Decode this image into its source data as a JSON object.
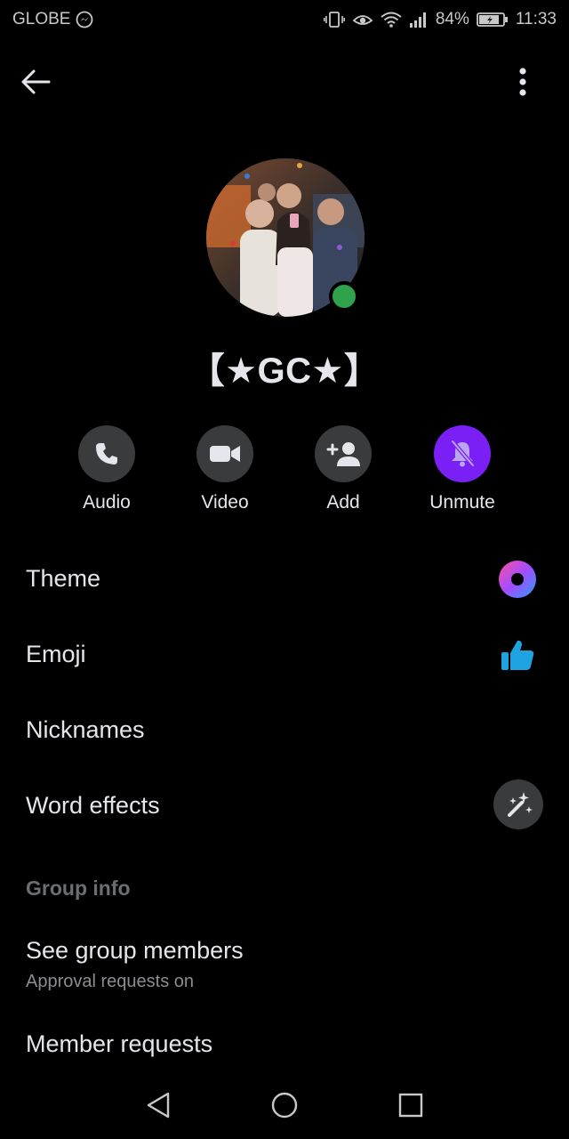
{
  "status_bar": {
    "carrier": "GLOBE",
    "battery": "84%",
    "time": "11:33"
  },
  "profile": {
    "name": "【★GC★】",
    "online": true,
    "presence_color": "#31a24c"
  },
  "actions": [
    {
      "label": "Audio",
      "icon": "phone-icon"
    },
    {
      "label": "Video",
      "icon": "video-camera-icon"
    },
    {
      "label": "Add",
      "icon": "add-person-icon"
    },
    {
      "label": "Unmute",
      "icon": "bell-muted-icon",
      "accent": "#7b20f5"
    }
  ],
  "customize": {
    "theme_label": "Theme",
    "emoji_label": "Emoji",
    "nicknames_label": "Nicknames",
    "word_effects_label": "Word effects"
  },
  "group_info": {
    "header": "Group info",
    "see_members_label": "See group members",
    "see_members_sub": "Approval requests on",
    "member_requests_label": "Member requests"
  },
  "colors": {
    "background": "#000000",
    "text": "#e4e6eb",
    "muted_text": "#6b6e72",
    "button_bg": "#3a3b3c",
    "accent": "#7b20f5",
    "emoji_color": "#1ea2e0"
  }
}
